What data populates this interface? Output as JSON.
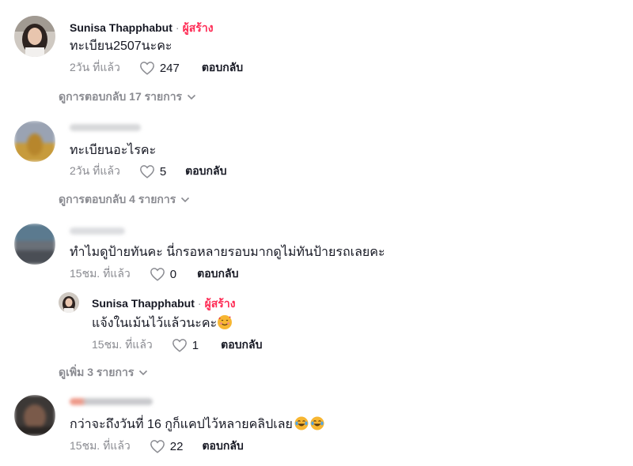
{
  "comments": [
    {
      "author": "Sunisa Thapphabut",
      "sep": "·",
      "creator_badge": "ผู้สร้าง",
      "text": "ทะเบียน2507นะคะ",
      "time": "2วัน ที่แล้ว",
      "likes": "247",
      "reply_label": "ตอบกลับ",
      "view_replies": "ดูการตอบกลับ 17 รายการ"
    },
    {
      "text": "ทะเบียนอะไรคะ",
      "time": "2วัน ที่แล้ว",
      "likes": "5",
      "reply_label": "ตอบกลับ",
      "view_replies": "ดูการตอบกลับ 4 รายการ"
    },
    {
      "text": "ทำไมดูป้ายทันคะ นี่กรอหลายรอบมากดูไม่ทันป้ายรถเลยคะ",
      "time": "15ชม. ที่แล้ว",
      "likes": "0",
      "reply_label": "ตอบกลับ",
      "reply": {
        "author": "Sunisa Thapphabut",
        "sep": "·",
        "creator_badge": "ผู้สร้าง",
        "text": "แจ้งในเม้นไว้แล้วนะคะ",
        "time": "15ชม. ที่แล้ว",
        "likes": "1",
        "reply_label": "ตอบกลับ"
      },
      "view_more": "ดูเพิ่ม 3 รายการ"
    },
    {
      "text": "กว่าจะถึงวันที่ 16 กูก็แคปไว้หลายคลิปเลย",
      "time": "15ชม. ที่แล้ว",
      "likes": "22",
      "reply_label": "ตอบกลับ"
    }
  ],
  "icons": {
    "like": "heart-outline-icon",
    "expand": "chevron-down-icon",
    "emoji_blush": "smiling-face-with-hearts-emoji",
    "emoji_laugh": "face-with-tears-of-joy-emoji"
  },
  "colors": {
    "creator": "#fe2c55",
    "muted": "#8a8b91",
    "text": "#161823"
  }
}
